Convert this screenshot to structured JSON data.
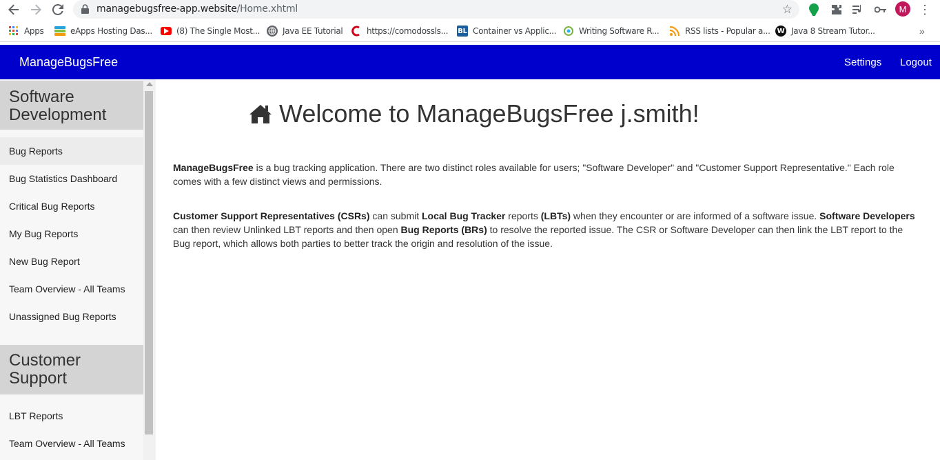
{
  "browser": {
    "url_domain": "managebugsfree-app.website",
    "url_path": "/Home.xhtml",
    "avatar_letter": "M",
    "bookmarks": [
      {
        "label": "Apps",
        "icon": "apps-grid-icon"
      },
      {
        "label": "eApps Hosting Das...",
        "icon": "eapps-icon"
      },
      {
        "label": "(8) The Single Most...",
        "icon": "youtube-icon"
      },
      {
        "label": "Java EE Tutorial",
        "icon": "globe-icon"
      },
      {
        "label": "https://comodossls...",
        "icon": "comodo-icon"
      },
      {
        "label": "Container vs Applic...",
        "icon": "bl-icon"
      },
      {
        "label": "Writing Software R...",
        "icon": "writing-icon"
      },
      {
        "label": "RSS lists - Popular a...",
        "icon": "rss-icon"
      },
      {
        "label": "Java 8 Stream Tutor...",
        "icon": "w-icon"
      }
    ]
  },
  "header": {
    "brand": "ManageBugsFree",
    "settings": "Settings",
    "logout": "Logout",
    "color": "#0000cc"
  },
  "sidebar": {
    "dev_title_line1": "Software",
    "dev_title_line2": "Development",
    "dev_items": [
      "Bug Reports",
      "Bug Statistics Dashboard",
      "Critical Bug Reports",
      "My Bug Reports",
      "New Bug Report",
      "Team Overview - All Teams",
      "Unassigned Bug Reports"
    ],
    "cs_title_line1": "Customer",
    "cs_title_line2": "Support",
    "cs_items": [
      "LBT Reports",
      "Team Overview - All Teams"
    ]
  },
  "main": {
    "welcome": "Welcome to ManageBugsFree j.smith!",
    "p1": {
      "b1": "ManageBugsFree",
      "t1": " is a bug tracking application. There are two distinct roles available for users; \"Software Developer\" and \"Customer Support Representative.\" Each role comes with a few distinct views and permissions."
    },
    "p2": {
      "b1": "Customer Support Representatives (CSRs)",
      "t1": " can submit ",
      "b2": "Local Bug Tracker",
      "t2": " reports ",
      "b3": "(LBTs)",
      "t3": " when they encounter or are informed of a software issue. ",
      "b4": "Software Developers",
      "t4": " can then review Unlinked LBT reports and then open ",
      "b5": "Bug Reports (BRs)",
      "t5": " to resolve the reported issue. The CSR or Software Developer can then link the LBT report to the Bug report, which allows both parties to better track the origin and resolution of the issue."
    }
  }
}
